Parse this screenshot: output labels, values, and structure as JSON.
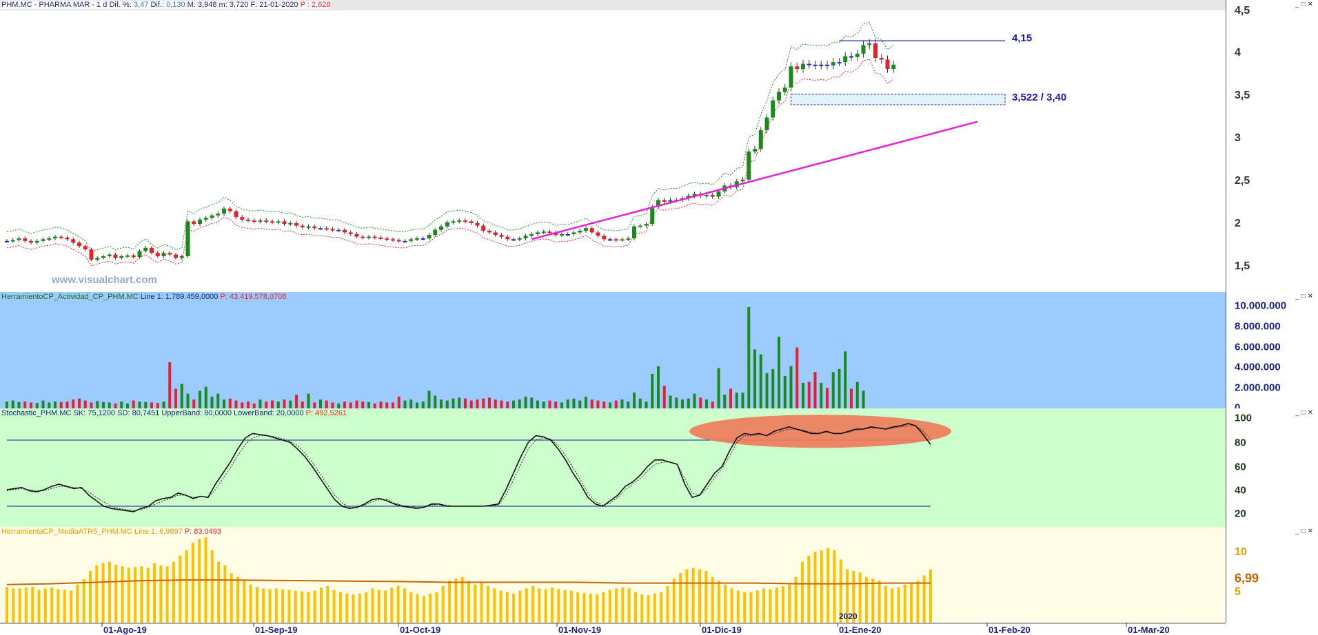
{
  "price_panel": {
    "header": {
      "symbol": "PHM.MC - PHARMA MAR -",
      "tf": "1 d",
      "dif_pct_label": "Dif. %:",
      "dif_pct": "3,47",
      "dif_label": "Dif.:",
      "dif": "0,130",
      "max_label": "M:",
      "max": "3,948",
      "min_label": "m:",
      "min": "3,720",
      "date_label": "F:",
      "date": "21-01-2020",
      "p_label": "P :",
      "p": "2,628"
    },
    "ticks": [
      "4,5",
      "4",
      "3,5",
      "3",
      "2,5",
      "2",
      "1,5"
    ],
    "level_high": "4,15",
    "level_zone": "3,522 / 3,40",
    "watermark": "www.visualchart.com"
  },
  "volume_panel": {
    "header": {
      "name": "HerramientoCP_Actividad_CP_PHM.MC",
      "line_label": "Line 1:",
      "line": "1.789.459,0000",
      "p_label": "P:",
      "p": "43.419.578,0708"
    },
    "ticks": [
      "10.000.000",
      "8.000.000",
      "6.000.000",
      "4.000.000",
      "2.000.000",
      "0"
    ]
  },
  "stoch_panel": {
    "header": {
      "name": "Stochastic_PHM.MC",
      "sk_label": "SK:",
      "sk": "75,1200",
      "sd_label": "SD:",
      "sd": "80,7451",
      "ub_label": "UpperBand:",
      "ub": "80,0000",
      "lb_label": "LowerBand:",
      "lb": "20,0000",
      "p_label": "P:",
      "p": "492,5261"
    },
    "ticks": [
      "100",
      "80",
      "60",
      "40",
      "20"
    ]
  },
  "atr_panel": {
    "header": {
      "name": "HerramientaCP_MediaATR5_PHM.MC",
      "line_label": "Line 1:",
      "line": "6,9897",
      "p_label": "P:",
      "p": "83,0493"
    },
    "ticks": [
      "10",
      "5"
    ],
    "last": "6,99"
  },
  "dates": [
    "01-Ago-19",
    "01-Sep-19",
    "01-Oct-19",
    "01-Nov-19",
    "01-Dic-19",
    "01-Ene-20",
    "01-Feb-20",
    "01-Mar-20"
  ],
  "year_marker": "2020",
  "colors": {
    "up": "#1a8a1a",
    "down": "#e8202a",
    "neutral": "#1f1fcf",
    "upper_band": "#1a8a1a",
    "lower_band": "#e8202a",
    "trendline": "#e81fd8",
    "vol_bg": "#9ccbff",
    "stoch_bg": "#ccffcc",
    "atr_bg": "#fffde6",
    "atr_bar": "#ffc000",
    "atr_avg": "#c86400"
  },
  "chart_data": [
    {
      "type": "candlestick",
      "title": "PHM.MC - PHARMA MAR",
      "ylim": [
        1.2,
        4.5
      ],
      "x_range": [
        "2019-07-08",
        "2020-03-15"
      ],
      "series": [
        {
          "name": "PHM.MC",
          "close": [
            1.8,
            1.81,
            1.83,
            1.8,
            1.78,
            1.8,
            1.82,
            1.83,
            1.85,
            1.84,
            1.82,
            1.78,
            1.74,
            1.7,
            1.58,
            1.6,
            1.62,
            1.64,
            1.6,
            1.62,
            1.63,
            1.61,
            1.68,
            1.72,
            1.66,
            1.62,
            1.66,
            1.64,
            1.6,
            1.62,
            2.03,
            2.0,
            2.05,
            2.07,
            2.1,
            2.12,
            2.18,
            2.15,
            2.08,
            2.05,
            2.04,
            2.03,
            2.04,
            2.03,
            2.02,
            2.03,
            2.0,
            2.01,
            1.98,
            1.96,
            1.97,
            1.95,
            1.95,
            1.94,
            1.93,
            1.93,
            1.9,
            1.88,
            1.85,
            1.84,
            1.85,
            1.84,
            1.83,
            1.82,
            1.81,
            1.8,
            1.8,
            1.82,
            1.83,
            1.83,
            1.87,
            1.93,
            1.97,
            2.02,
            2.03,
            2.04,
            2.03,
            2.01,
            1.98,
            1.92,
            1.9,
            1.87,
            1.85,
            1.82,
            1.82,
            1.83,
            1.86,
            1.88,
            1.9,
            1.91,
            1.9,
            1.87,
            1.88,
            1.88,
            1.9,
            1.92,
            1.95,
            1.9,
            1.86,
            1.82,
            1.82,
            1.81,
            1.82,
            1.83,
            1.97,
            1.98,
            2.0,
            2.2,
            2.28,
            2.26,
            2.28,
            2.28,
            2.3,
            2.33,
            2.35,
            2.33,
            2.34,
            2.32,
            2.38,
            2.45,
            2.43,
            2.5,
            2.52,
            2.85,
            2.88,
            3.1,
            3.25,
            3.45,
            3.55,
            3.6,
            3.85,
            3.82,
            3.88,
            3.87,
            3.86,
            3.87,
            3.86,
            3.9,
            3.9,
            3.97,
            3.96,
            4.0,
            4.1,
            4.12,
            3.95,
            3.93,
            3.82,
            3.87
          ]
        }
      ],
      "levels": [
        {
          "label": "4,15",
          "value": 4.15
        },
        {
          "label": "3,522 / 3,40",
          "from": 3.4,
          "to": 3.522
        }
      ],
      "bands": "upper/lower envelope",
      "trendline": {
        "from": [
          1.82
        ],
        "to": [
          3.2
        ]
      }
    },
    {
      "type": "bar",
      "title": "HerramientoCP_Actividad_CP_PHM.MC",
      "ylim": [
        0,
        11000000
      ],
      "series": [
        {
          "name": "Line 1",
          "values": [
            700000,
            800000,
            650000,
            700000,
            600000,
            550000,
            800000,
            600000,
            700000,
            650000,
            700000,
            900000,
            1000000,
            800000,
            600000,
            750000,
            650000,
            600000,
            500000,
            700000,
            500000,
            800000,
            700000,
            650000,
            600000,
            550000,
            700000,
            4700000,
            2000000,
            2500000,
            1500000,
            900000,
            1800000,
            2200000,
            1200000,
            1500000,
            900000,
            1000000,
            800000,
            600000,
            700000,
            500000,
            900000,
            700000,
            800000,
            700000,
            900000,
            800000,
            1400000,
            700000,
            1500000,
            600000,
            900000,
            800000,
            600000,
            500000,
            700000,
            600000,
            800000,
            700000,
            650000,
            500000,
            700000,
            600000,
            600000,
            1200000,
            800000,
            900000,
            600000,
            700000,
            1800000,
            1300000,
            900000,
            800000,
            1000000,
            1100000,
            1000000,
            800000,
            900000,
            1000000,
            1100000,
            900000,
            800000,
            700000,
            800000,
            900000,
            1200000,
            1100000,
            800000,
            700000,
            800000,
            700000,
            600000,
            900000,
            1000000,
            800000,
            1200000,
            900000,
            800000,
            700000,
            600000,
            800000,
            900000,
            700000,
            1600000,
            1000000,
            700000,
            3500000,
            4300000,
            2300000,
            1300000,
            1100000,
            900000,
            1000000,
            1500000,
            1100000,
            900000,
            700000,
            4100000,
            1400000,
            2000000,
            1600000,
            1600000,
            10300000,
            6000000,
            5500000,
            3600000,
            4000000,
            7300000,
            3300000,
            4300000,
            6200000,
            2600000,
            2700000,
            3700000,
            2600000,
            2100000,
            3700000,
            4000000,
            5800000,
            2000000,
            2700000,
            1800000
          ]
        }
      ]
    },
    {
      "type": "line",
      "title": "Stochastic_PHM.MC",
      "ylim": [
        10,
        100
      ],
      "bands": [
        80,
        20
      ],
      "series": [
        {
          "name": "SK",
          "values": [
            35,
            36,
            37,
            34,
            33,
            35,
            38,
            40,
            38,
            36,
            37,
            30,
            25,
            20,
            18,
            17,
            16,
            15,
            18,
            20,
            25,
            27,
            28,
            32,
            30,
            27,
            29,
            28,
            40,
            50,
            60,
            72,
            82,
            86,
            85,
            84,
            82,
            80,
            78,
            72,
            65,
            56,
            46,
            36,
            26,
            20,
            18,
            19,
            22,
            26,
            27,
            25,
            22,
            20,
            19,
            18,
            19,
            22,
            22,
            20,
            20,
            20,
            20,
            20,
            20,
            21,
            22,
            35,
            50,
            65,
            78,
            84,
            83,
            80,
            72,
            62,
            50,
            40,
            28,
            22,
            20,
            25,
            30,
            38,
            42,
            48,
            56,
            62,
            62,
            60,
            58,
            40,
            28,
            30,
            40,
            50,
            56,
            70,
            82,
            86,
            85,
            86,
            84,
            88,
            90,
            92,
            90,
            88,
            86,
            86,
            88,
            86,
            86,
            88,
            90,
            90,
            92,
            91,
            90,
            92,
            93,
            95,
            93,
            85,
            76
          ]
        },
        {
          "name": "SD",
          "values": [
            34,
            35,
            36,
            35,
            34,
            34,
            36,
            38,
            38,
            37,
            36,
            33,
            28,
            24,
            20,
            18,
            17,
            16,
            17,
            19,
            22,
            25,
            27,
            30,
            30,
            28,
            29,
            28,
            35,
            45,
            55,
            66,
            76,
            82,
            84,
            84,
            83,
            81,
            79,
            75,
            68,
            60,
            50,
            40,
            30,
            23,
            19,
            19,
            21,
            24,
            26,
            26,
            23,
            21,
            20,
            19,
            19,
            21,
            22,
            21,
            20,
            20,
            20,
            20,
            20,
            20,
            21,
            30,
            44,
            58,
            72,
            80,
            82,
            81,
            75,
            66,
            55,
            44,
            32,
            24,
            21,
            23,
            28,
            35,
            40,
            45,
            52,
            58,
            60,
            60,
            58,
            45,
            32,
            30,
            36,
            46,
            54,
            65,
            78,
            84,
            84,
            85,
            84,
            86,
            88,
            90,
            90,
            89,
            87,
            86,
            87,
            86,
            86,
            87,
            89,
            90,
            91,
            91,
            90,
            91,
            92,
            93,
            93,
            88,
            81
          ]
        }
      ]
    },
    {
      "type": "bar",
      "title": "HerramientaCP_MediaATR5_PHM.MC",
      "ylim": [
        0,
        11.5
      ],
      "series": [
        {
          "name": "Line 1",
          "values": [
            4.7,
            4.5,
            4.5,
            4.6,
            4.7,
            4.3,
            4.5,
            4.6,
            4.4,
            4.3,
            4.2,
            5.0,
            5.7,
            6.8,
            7.5,
            7.8,
            8.0,
            7.6,
            7.4,
            7.2,
            7.3,
            7.4,
            7.2,
            7.8,
            7.5,
            7.4,
            8.0,
            8.8,
            9.5,
            10.5,
            11.0,
            11.2,
            9.5,
            8.0,
            7.5,
            6.5,
            6.0,
            5.5,
            5.0,
            4.7,
            4.5,
            4.4,
            4.5,
            4.4,
            4.3,
            4.2,
            4.1,
            4.0,
            4.2,
            4.6,
            4.8,
            4.3,
            4.0,
            3.8,
            3.7,
            3.8,
            4.0,
            4.5,
            4.3,
            4.2,
            4.6,
            4.8,
            4.5,
            4.0,
            3.7,
            3.5,
            3.8,
            4.0,
            4.8,
            5.5,
            5.8,
            6.0,
            5.5,
            5.0,
            5.2,
            4.8,
            4.5,
            4.2,
            4.0,
            3.8,
            4.2,
            4.5,
            4.8,
            4.5,
            4.4,
            4.6,
            4.4,
            4.3,
            4.2,
            4.0,
            3.9,
            3.8,
            3.7,
            4.0,
            4.3,
            4.5,
            4.6,
            4.5,
            4.0,
            3.7,
            3.6,
            3.8,
            4.0,
            4.8,
            5.8,
            6.5,
            7.0,
            7.2,
            7.0,
            6.8,
            6.0,
            5.5,
            5.0,
            4.5,
            4.2,
            4.0,
            4.0,
            4.2,
            4.5,
            4.4,
            4.6,
            4.8,
            5.0,
            6.0,
            8.0,
            8.8,
            9.3,
            9.5,
            9.8,
            9.5,
            8.3,
            7.0,
            6.8,
            6.6,
            6.0,
            5.8,
            5.5,
            4.8,
            4.5,
            4.6,
            5.0,
            5.2,
            5.5,
            6.2,
            6.99
          ]
        },
        {
          "name": "Media",
          "values": [
            5.0,
            5.1,
            5.3,
            5.5,
            5.6,
            5.6,
            5.55,
            5.5,
            5.45,
            5.4,
            5.3,
            5.3,
            5.3,
            5.3,
            5.2,
            5.2,
            5.2,
            5.2,
            5.1,
            5.1,
            5.2,
            5.2
          ]
        }
      ],
      "last": "6,99"
    }
  ]
}
